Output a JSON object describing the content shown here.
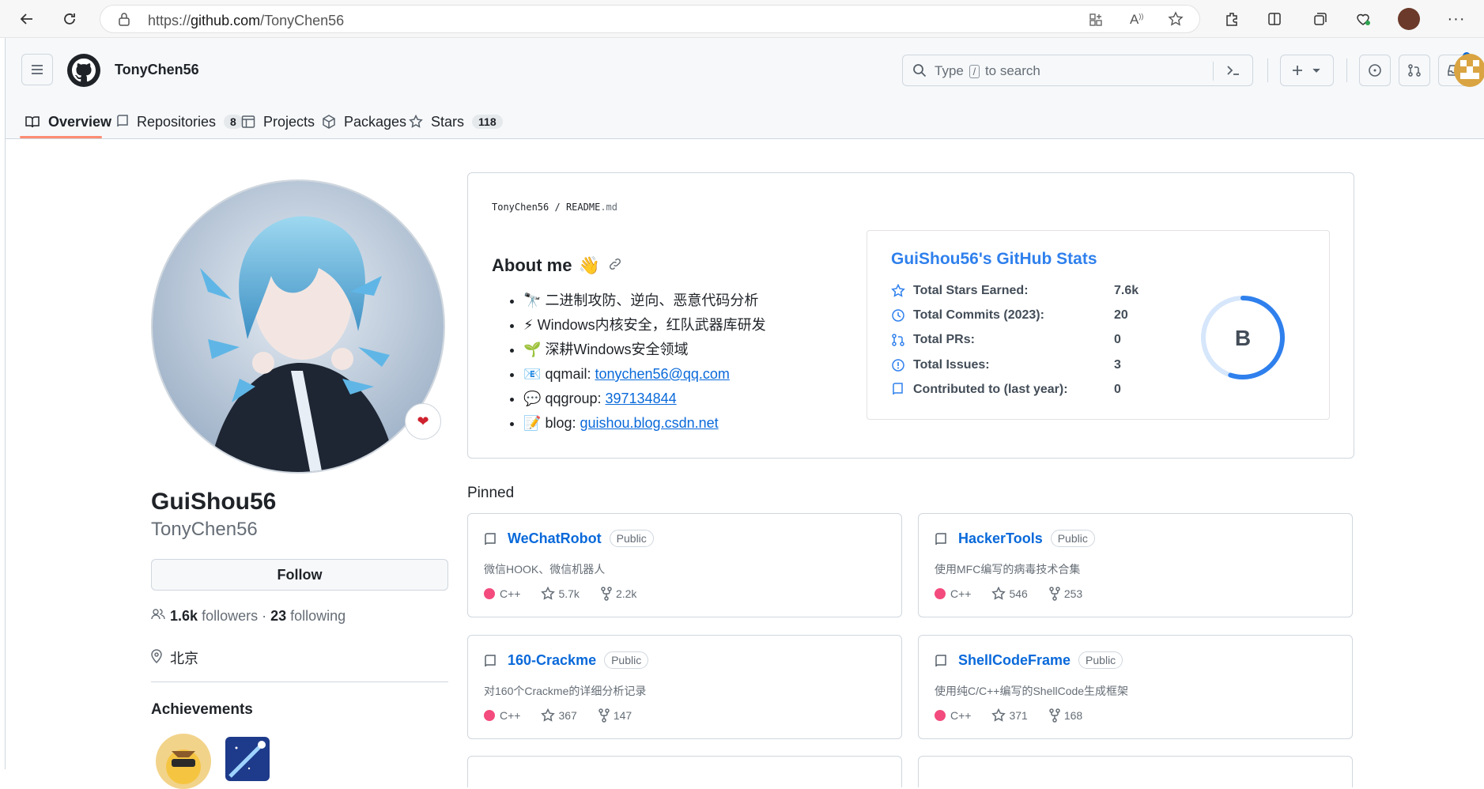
{
  "browser": {
    "url_prefix": "https://",
    "url_host": "github.com",
    "url_path": "/TonyChen56"
  },
  "header": {
    "username": "TonyChen56",
    "search_prefix": "Type",
    "search_key": "/",
    "search_suffix": "to search"
  },
  "tabs": [
    {
      "label": "Overview",
      "count": ""
    },
    {
      "label": "Repositories",
      "count": "8"
    },
    {
      "label": "Projects",
      "count": ""
    },
    {
      "label": "Packages",
      "count": ""
    },
    {
      "label": "Stars",
      "count": "118"
    }
  ],
  "profile": {
    "name": "GuiShou56",
    "login": "TonyChen56",
    "follow_label": "Follow",
    "followers_count": "1.6k",
    "followers_label": "followers",
    "sep": "·",
    "following_count": "23",
    "following_label": "following",
    "location": "北京",
    "achievements_title": "Achievements"
  },
  "readme": {
    "path_owner": "TonyChen56",
    "path_sep": "/",
    "path_file": "README",
    "path_ext": ".md",
    "heading": "About me",
    "heading_emoji": "👋",
    "items": [
      {
        "emoji": "🔭",
        "text": "二进制攻防、逆向、恶意代码分析",
        "link": ""
      },
      {
        "emoji": "⚡",
        "text": "Windows内核安全，红队武器库研发",
        "link": ""
      },
      {
        "emoji": "🌱",
        "text": "深耕Windows安全领域",
        "link": ""
      },
      {
        "emoji": "📧",
        "text": "qqmail: ",
        "link": "tonychen56@qq.com"
      },
      {
        "emoji": "💬",
        "text": "qqgroup: ",
        "link": "397134844"
      },
      {
        "emoji": "📝",
        "text": "blog: ",
        "link": "guishou.blog.csdn.net"
      }
    ]
  },
  "stats": {
    "title": "GuiShou56's GitHub Stats",
    "rows": [
      {
        "label": "Total Stars Earned:",
        "value": "7.6k"
      },
      {
        "label": "Total Commits (2023):",
        "value": "20"
      },
      {
        "label": "Total PRs:",
        "value": "0"
      },
      {
        "label": "Total Issues:",
        "value": "3"
      },
      {
        "label": "Contributed to (last year):",
        "value": "0"
      }
    ],
    "rank": "B",
    "rank_progress": 0.55,
    "accent": "#2f80ed"
  },
  "pinned": {
    "title": "Pinned",
    "repos": [
      {
        "name": "WeChatRobot",
        "visibility": "Public",
        "desc": "微信HOOK、微信机器人",
        "lang": "C++",
        "stars": "5.7k",
        "forks": "2.2k"
      },
      {
        "name": "HackerTools",
        "visibility": "Public",
        "desc": "使用MFC编写的病毒技术合集",
        "lang": "C++",
        "stars": "546",
        "forks": "253"
      },
      {
        "name": "160-Crackme",
        "visibility": "Public",
        "desc": "对160个Crackme的详细分析记录",
        "lang": "C++",
        "stars": "367",
        "forks": "147"
      },
      {
        "name": "ShellCodeFrame",
        "visibility": "Public",
        "desc": "使用纯C/C++编写的ShellCode生成框架",
        "lang": "C++",
        "stars": "371",
        "forks": "168"
      }
    ]
  }
}
